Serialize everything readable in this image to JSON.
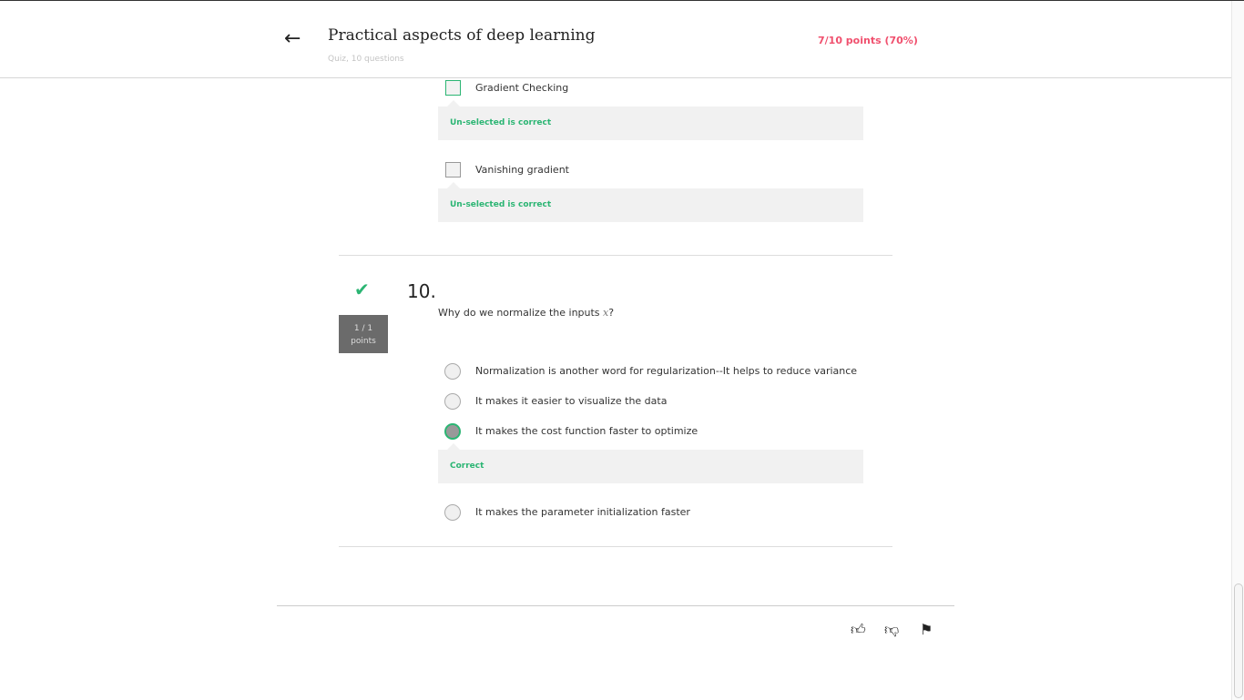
{
  "header": {
    "title": "Practical aspects of deep learning",
    "subtitle": "Quiz, 10 questions",
    "score": "7/10 points (70%)",
    "back_icon": "arrow-left-icon"
  },
  "q9": {
    "options": [
      {
        "label": "Gradient Checking",
        "feedback": "Un-selected is correct"
      },
      {
        "label": "Vanishing gradient",
        "feedback": "Un-selected is correct"
      }
    ]
  },
  "q10": {
    "number": "10.",
    "points_value": "1 / 1",
    "points_label": "points",
    "question": "Why do we normalize the inputs ",
    "var": "x",
    "question_end": "?",
    "options": [
      {
        "label": "Normalization is another word for regularization--It helps to reduce variance",
        "selected": false
      },
      {
        "label": "It makes it easier to visualize the data",
        "selected": false
      },
      {
        "label": "It makes the cost function faster to optimize",
        "selected": true,
        "feedback": "Correct"
      },
      {
        "label": "It makes the parameter initialization faster",
        "selected": false
      }
    ]
  },
  "colors": {
    "correct": "#2bb573",
    "score": "#f0506e"
  },
  "footer": {
    "icons": [
      "thumbs-up-icon",
      "thumbs-down-icon",
      "flag-icon"
    ]
  }
}
